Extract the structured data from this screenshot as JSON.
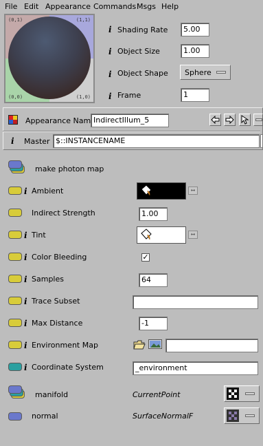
{
  "menu": [
    "File",
    "Edit",
    "Appearance",
    "Commands",
    "Msgs",
    "Help"
  ],
  "preview": {
    "tl": "(0,1)",
    "tr": "(1,1)",
    "bl": "(0,0)",
    "br": "(1,0)"
  },
  "props": {
    "shading_rate_label": "Shading Rate",
    "shading_rate_value": "5.00",
    "object_size_label": "Object Size",
    "object_size_value": "1.00",
    "object_shape_label": "Object Shape",
    "object_shape_value": "Sphere",
    "frame_label": "Frame",
    "frame_value": "1"
  },
  "appearance": {
    "name_label": "Appearance Name",
    "name_value": "IndirectIllum_5",
    "master_label": "Master",
    "master_value": "$::INSTANCENAME"
  },
  "params": {
    "make_photon_map": "make photon map",
    "ambient": "Ambient",
    "indirect_strength": "Indirect Strength",
    "indirect_strength_value": "1.00",
    "tint": "Tint",
    "color_bleeding": "Color Bleeding",
    "color_bleeding_check": "✓",
    "samples": "Samples",
    "samples_value": "64",
    "trace_subset": "Trace Subset",
    "trace_subset_value": "",
    "max_distance": "Max Distance",
    "max_distance_value": "-1",
    "environment_map": "Environment Map",
    "environment_map_value": "",
    "coordinate_system": "Coordinate System",
    "coordinate_system_value": "_environment",
    "manifold": "manifold",
    "manifold_type": "CurrentPoint",
    "normal": "normal",
    "normal_type": "SurfaceNormalF"
  },
  "colors": {
    "connector_yellow": "#d8cc3a",
    "connector_blue": "#6a78cc",
    "connector_teal": "#2aa0a0",
    "background": "#bdbdbd"
  }
}
